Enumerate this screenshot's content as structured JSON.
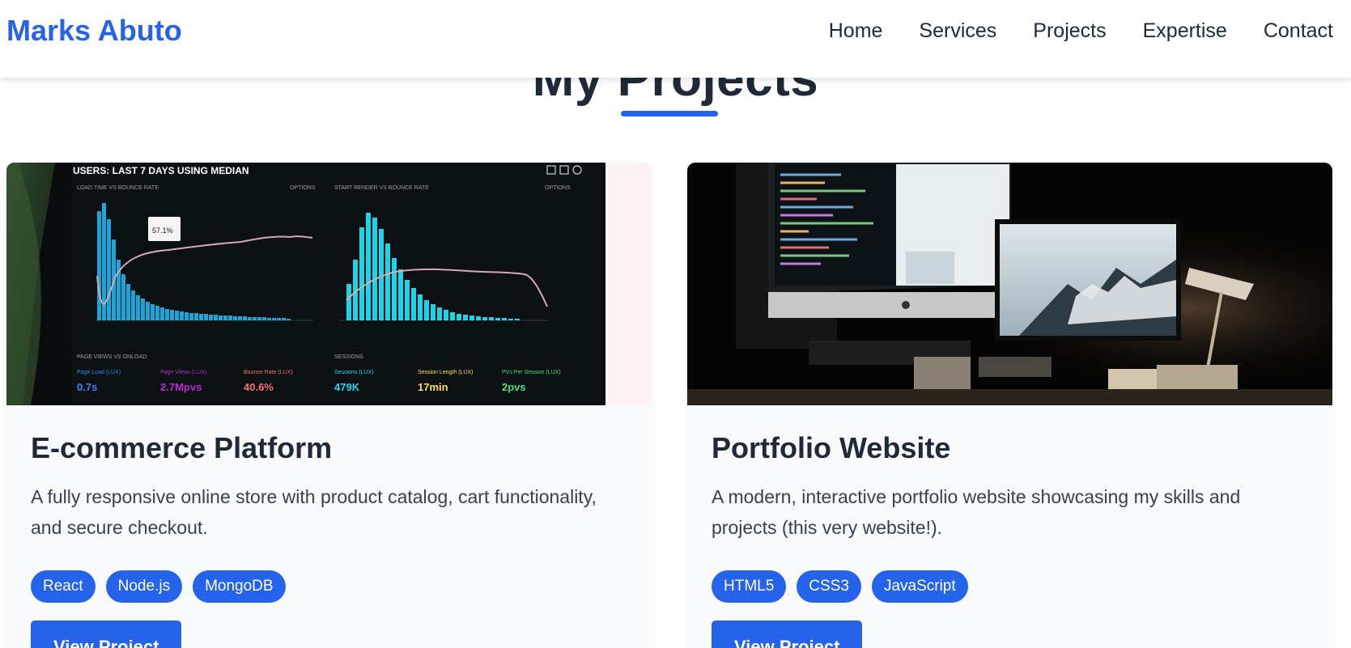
{
  "nav": {
    "brand": "Marks Abuto",
    "links": [
      "Home",
      "Services",
      "Projects",
      "Expertise",
      "Contact"
    ]
  },
  "section": {
    "title": "My Projects"
  },
  "projects": [
    {
      "title": "E-commerce Platform",
      "description": "A fully responsive online store with product catalog, cart functionality, and secure checkout.",
      "tags": [
        "React",
        "Node.js",
        "MongoDB"
      ],
      "button": "View Project",
      "image": {
        "header": "USERS: LAST 7 DAYS USING MEDIAN",
        "panel1": "LOAD TIME VS BOUNCE RATE",
        "panel2": "START RENDER VS BOUNCE RATE",
        "options": "OPTIONS",
        "tooltip": "57.1%",
        "bottom_left": "PAGE VIEWS VS ONLOAD",
        "bottom_right": "SESSIONS",
        "metrics": [
          {
            "label": "Page Load (LUX)",
            "value": "0.7s",
            "color": "#3b82f6"
          },
          {
            "label": "Page Views (LUX)",
            "value": "2.7Mpvs",
            "color": "#c026d3"
          },
          {
            "label": "Bounce Rate (LUX)",
            "value": "40.6%",
            "color": "#f87171"
          },
          {
            "label": "Sessions (LUX)",
            "value": "479K",
            "color": "#22d3ee"
          },
          {
            "label": "Session Length (LUX)",
            "value": "17min",
            "color": "#fde047"
          },
          {
            "label": "PVs Per Session (LUX)",
            "value": "2pvs",
            "color": "#4ade80"
          }
        ]
      }
    },
    {
      "title": "Portfolio Website",
      "description": "A modern, interactive portfolio website showcasing my skills and projects (this very website!).",
      "tags": [
        "HTML5",
        "CSS3",
        "JavaScript"
      ],
      "button": "View Project"
    }
  ]
}
